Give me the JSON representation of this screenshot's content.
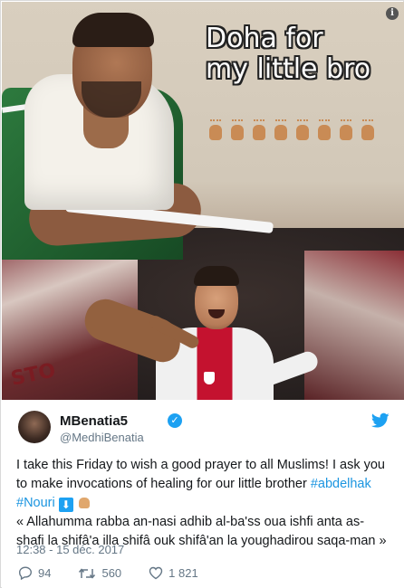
{
  "media": {
    "info_icon": "i",
    "caption_line1": "Doha for",
    "caption_line2": "my little bro",
    "banner_text": "STO",
    "hands_icon": "raising-hands-emoji",
    "hands_count": 8
  },
  "tweet": {
    "display_name": "MBenatia5",
    "handle": "@MedhiBenatia",
    "verified": true,
    "text_part1": "I take this Friday to wish a good prayer to all Muslims! I ask you to make invocations of healing for our little brother ",
    "hashtag1": "#abdelhak",
    "hashtag2": "#Nouri",
    "down_arrow_glyph": "⬇",
    "quote": "« Allahumma rabba an-nasi adhib al-ba'ss oua ishfi anta as-shafi la shifâ'a illa shifâ ouk shifâ'an la youghadirou saqa-man »",
    "timestamp": "12:38 - 15 déc. 2017",
    "replies": "94",
    "retweets": "560",
    "likes": "1 821"
  },
  "colors": {
    "link": "#1b95e0",
    "twitter_blue": "#1da1f2",
    "muted": "#657786"
  }
}
